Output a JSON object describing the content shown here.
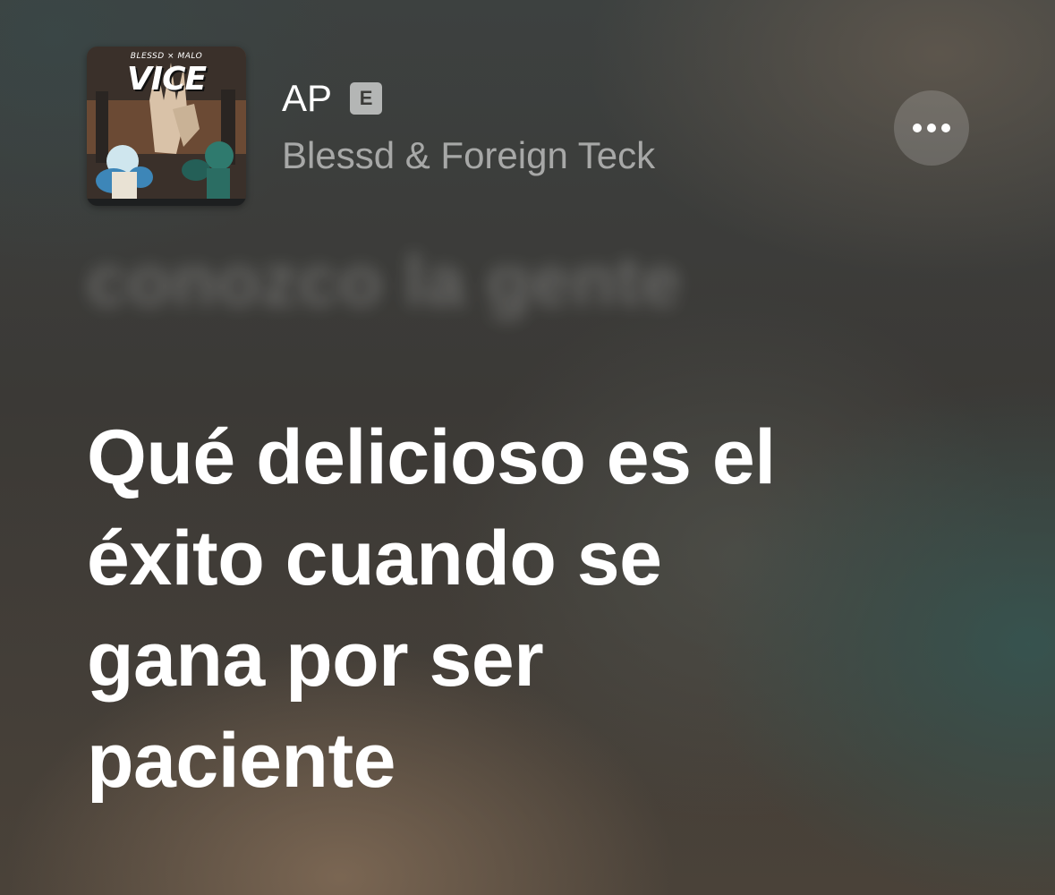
{
  "track": {
    "title": "AP",
    "explicit_badge": "E",
    "artist": "Blessd & Foreign Teck"
  },
  "artwork": {
    "top_text": "BLESSD × MALO",
    "title_text": "VICE"
  },
  "lyrics": {
    "previous_line": "conozco la gente",
    "current_lines": [
      "Qué delicioso es el",
      "éxito cuando se",
      "gana por ser",
      "paciente"
    ]
  },
  "icons": {
    "more": "ellipsis-icon",
    "explicit": "explicit-icon"
  },
  "colors": {
    "text_primary": "#ffffff",
    "text_secondary": "rgba(255,255,255,0.55)",
    "button_bg": "rgba(255,255,255,0.17)"
  }
}
